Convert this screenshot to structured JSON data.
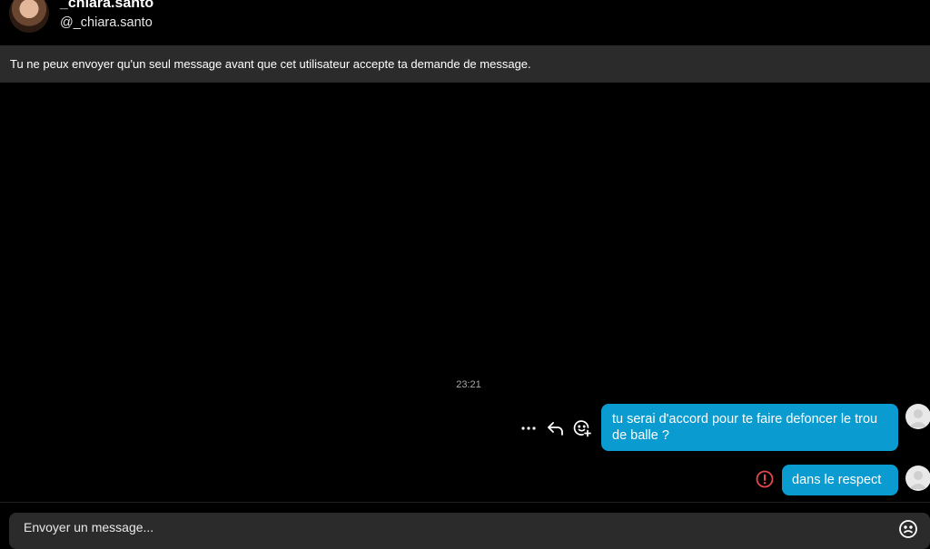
{
  "header": {
    "display_name": "_chiara.santo",
    "username": "@_chiara.santo"
  },
  "notice": "Tu ne peux envoyer qu'un seul message avant que cet utilisateur accepte ta demande de message.",
  "conversation": {
    "timestamp": "23:21",
    "messages": [
      {
        "text": "tu serai d'accord pour te faire defoncer le trou de balle ?",
        "status": "sent"
      },
      {
        "text": "dans le respect",
        "status": "error"
      }
    ],
    "actions": {
      "more": "…",
      "more_icon": "more-icon",
      "reply_icon": "reply-icon",
      "react_icon": "add-reaction-icon"
    }
  },
  "composer": {
    "placeholder": "Envoyer un message..."
  },
  "colors": {
    "background": "#000000",
    "notice_bg": "#2b2b2b",
    "bubble": "#0a9bd0",
    "error": "#e5484d"
  }
}
